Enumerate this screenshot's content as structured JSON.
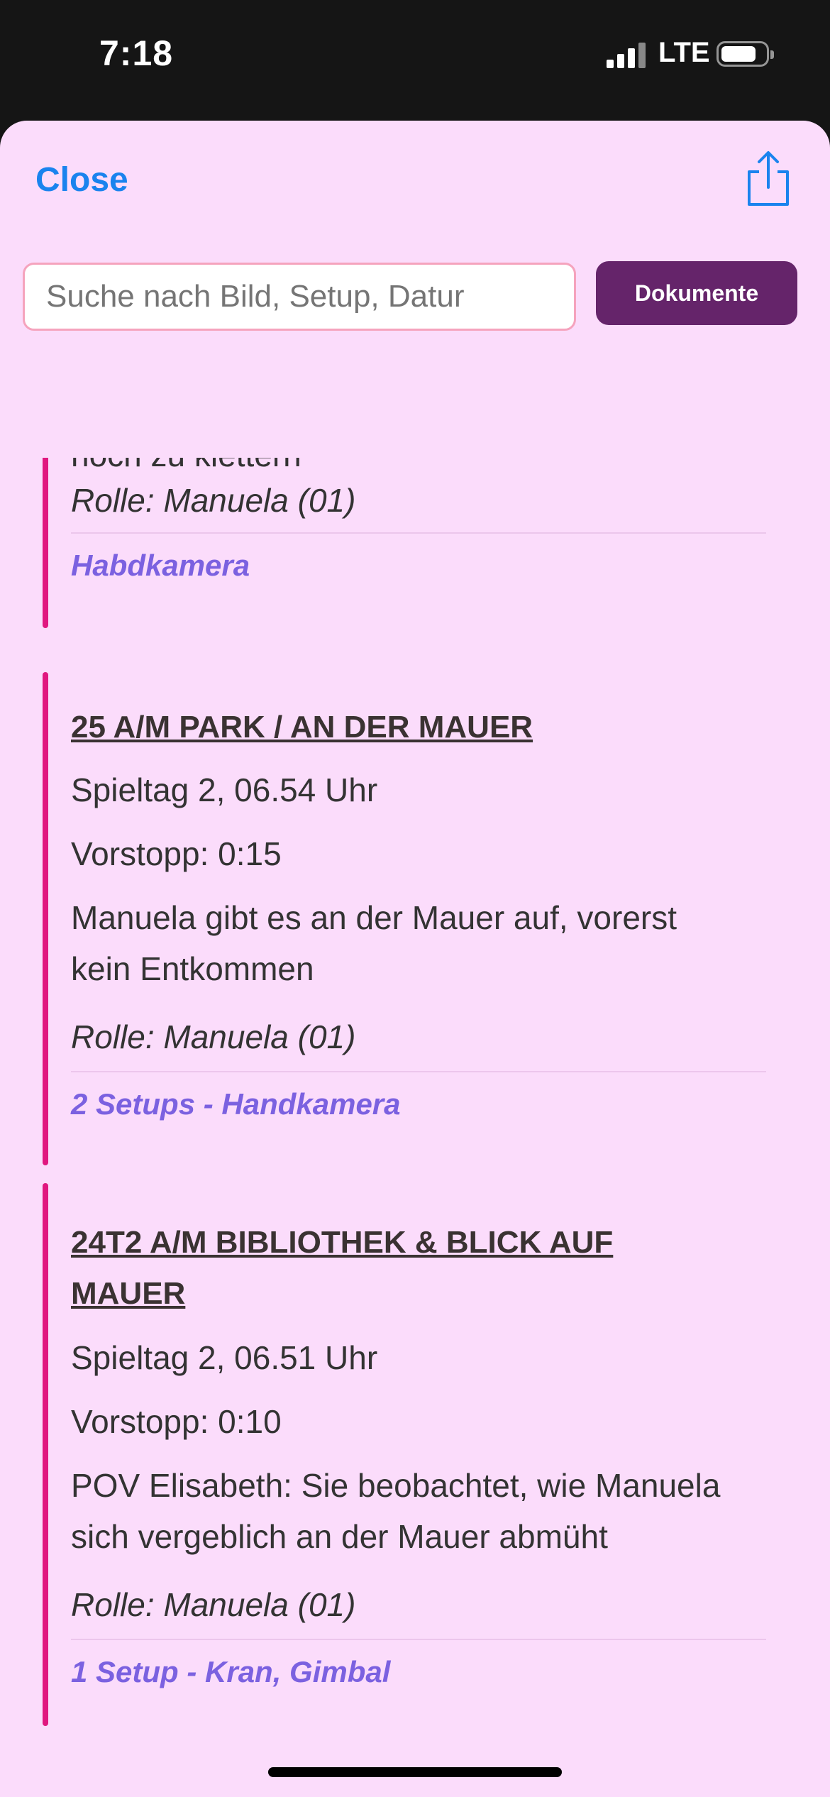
{
  "status_bar": {
    "time": "7:18",
    "network": "LTE"
  },
  "header": {
    "close_label": "Close",
    "share_icon": "share-icon"
  },
  "search": {
    "placeholder": "Suche nach Bild, Setup, Datur",
    "value": ""
  },
  "documents_button": "Dokumente",
  "cards": [
    {
      "partial_text": "noch zu klettern",
      "role": "Rolle: Manuela (01)",
      "footer": "Habdkamera"
    },
    {
      "title": "25 A/M PARK / AN DER MAUER",
      "day": "Spieltag 2, 06.54 Uhr",
      "vorstopp": "Vorstopp: 0:15",
      "desc1": "Manuela gibt es an der Mauer auf, vorerst",
      "desc2": "kein Entkommen",
      "role": "Rolle: Manuela (01)",
      "footer": "2 Setups - Handkamera"
    },
    {
      "title1": "24T2 A/M BIBLIOTHEK & BLICK AUF",
      "title2": "MAUER",
      "day": "Spieltag 2, 06.51 Uhr",
      "vorstopp": "Vorstopp: 0:10",
      "desc1": "POV Elisabeth: Sie beobachtet, wie Manuela",
      "desc2": "sich vergeblich an der Mauer abmüht",
      "role": "Rolle: Manuela (01)",
      "footer": "1 Setup - Kran, Gimbal"
    }
  ],
  "colors": {
    "accent": "#e0177f",
    "link": "#1a83ee",
    "setup": "#7b61e0",
    "button": "#65246a",
    "sheet": "#fbdcfb"
  }
}
